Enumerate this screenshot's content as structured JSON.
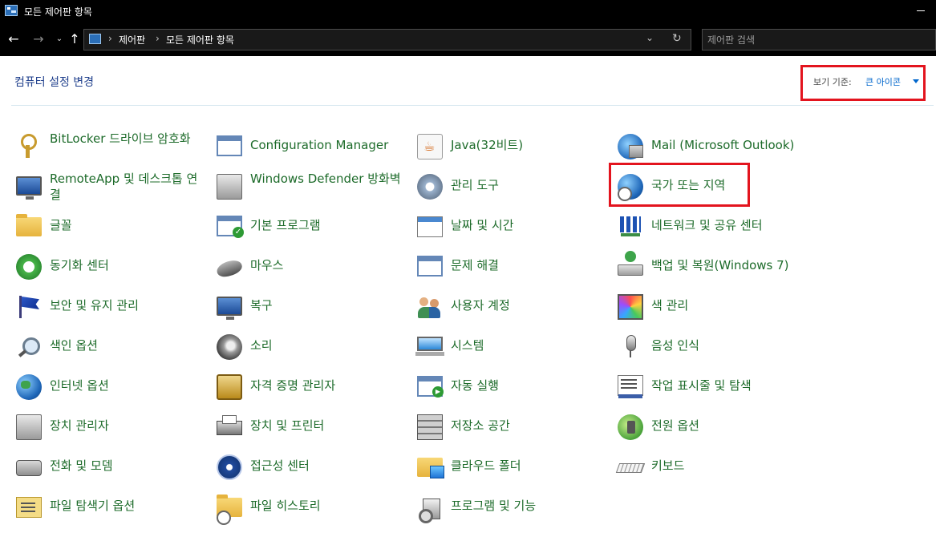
{
  "window": {
    "title": "모든 제어판 항목",
    "icon": "control-panel-icon"
  },
  "navigation": {
    "back_icon": "←",
    "forward_icon": "→",
    "recent_icon": "⌄",
    "up_icon": "↑",
    "breadcrumb": [
      "제어판",
      "모든 제어판 항목"
    ],
    "separator": "›",
    "dropdown_icon": "⌄",
    "refresh_icon": "↻",
    "search_placeholder": "제어판 검색"
  },
  "header": {
    "title": "컴퓨터 설정 변경",
    "view_by_label": "보기 기준:",
    "view_by_value": "큰 아이콘"
  },
  "items": [
    {
      "label": "BitLocker 드라이브 암호화",
      "icon": "bitlocker-key-icon"
    },
    {
      "label": "RemoteApp 및 데스크톱 연결",
      "icon": "remote-desktop-icon"
    },
    {
      "label": "글꼴",
      "icon": "font-folder-icon"
    },
    {
      "label": "동기화 센터",
      "icon": "sync-center-icon"
    },
    {
      "label": "보안 및 유지 관리",
      "icon": "security-flag-icon"
    },
    {
      "label": "색인 옵션",
      "icon": "indexing-icon"
    },
    {
      "label": "인터넷 옵션",
      "icon": "internet-options-icon"
    },
    {
      "label": "장치 관리자",
      "icon": "device-manager-icon"
    },
    {
      "label": "전화 및 모뎀",
      "icon": "phone-modem-icon"
    },
    {
      "label": "파일 탐색기 옵션",
      "icon": "file-explorer-options-icon"
    },
    {
      "label": "Configuration Manager",
      "icon": "configuration-manager-icon"
    },
    {
      "label": "Windows Defender 방화벽",
      "icon": "firewall-icon"
    },
    {
      "label": "기본 프로그램",
      "icon": "default-programs-icon"
    },
    {
      "label": "마우스",
      "icon": "mouse-icon"
    },
    {
      "label": "복구",
      "icon": "recovery-icon"
    },
    {
      "label": "소리",
      "icon": "sound-icon"
    },
    {
      "label": "자격 증명 관리자",
      "icon": "credential-manager-icon"
    },
    {
      "label": "장치 및 프린터",
      "icon": "printer-icon"
    },
    {
      "label": "접근성 센터",
      "icon": "accessibility-icon"
    },
    {
      "label": "파일 히스토리",
      "icon": "file-history-icon"
    },
    {
      "label": "Java(32비트)",
      "icon": "java-icon"
    },
    {
      "label": "관리 도구",
      "icon": "admin-tools-icon"
    },
    {
      "label": "날짜 및 시간",
      "icon": "date-time-icon"
    },
    {
      "label": "문제 해결",
      "icon": "troubleshooting-icon"
    },
    {
      "label": "사용자 계정",
      "icon": "user-accounts-icon"
    },
    {
      "label": "시스템",
      "icon": "system-icon"
    },
    {
      "label": "자동 실행",
      "icon": "autoplay-icon"
    },
    {
      "label": "저장소 공간",
      "icon": "storage-spaces-icon"
    },
    {
      "label": "클라우드 폴더",
      "icon": "cloud-folder-icon"
    },
    {
      "label": "프로그램 및 기능",
      "icon": "programs-features-icon"
    },
    {
      "label": "Mail (Microsoft Outlook)",
      "icon": "mail-icon"
    },
    {
      "label": "국가 또는 지역",
      "icon": "region-globe-icon"
    },
    {
      "label": "네트워크 및 공유 센터",
      "icon": "network-icon"
    },
    {
      "label": "백업 및 복원(Windows 7)",
      "icon": "backup-icon"
    },
    {
      "label": "색 관리",
      "icon": "color-management-icon"
    },
    {
      "label": "음성 인식",
      "icon": "microphone-icon"
    },
    {
      "label": "작업 표시줄 및 탐색",
      "icon": "taskbar-icon"
    },
    {
      "label": "전원 옵션",
      "icon": "power-options-icon"
    },
    {
      "label": "키보드",
      "icon": "keyboard-icon"
    }
  ],
  "colors": {
    "titlebar": "#000000",
    "item_text": "#1d6b2a",
    "heading": "#1f3f8c",
    "link": "#0066cc",
    "highlight": "#e3141e"
  }
}
